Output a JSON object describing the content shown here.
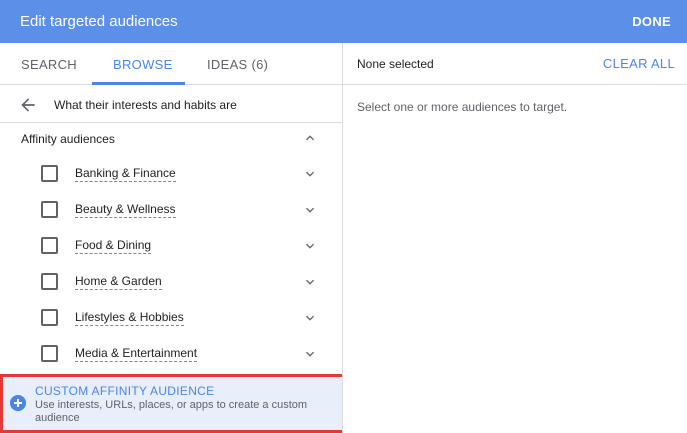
{
  "header": {
    "title": "Edit targeted audiences",
    "done_label": "DONE"
  },
  "tabs": [
    {
      "label": "SEARCH",
      "active": false
    },
    {
      "label": "BROWSE",
      "active": true
    },
    {
      "label": "IDEAS",
      "count": "(6)",
      "active": false
    }
  ],
  "breadcrumb": {
    "text": "What their interests and habits are",
    "back_icon": "arrow-back-icon"
  },
  "section": {
    "title": "Affinity audiences",
    "expanded": true
  },
  "items": [
    {
      "label": "Banking & Finance",
      "checked": false
    },
    {
      "label": "Beauty & Wellness",
      "checked": false
    },
    {
      "label": "Food & Dining",
      "checked": false
    },
    {
      "label": "Home & Garden",
      "checked": false
    },
    {
      "label": "Lifestyles & Hobbies",
      "checked": false
    },
    {
      "label": "Media & Entertainment",
      "checked": false
    }
  ],
  "custom": {
    "title": "CUSTOM AFFINITY AUDIENCE",
    "description": "Use interests, URLs, places, or apps to create a custom audience",
    "icon": "plus-circle-icon"
  },
  "right": {
    "status": "None selected",
    "clear_label": "CLEAR ALL",
    "hint": "Select one or more audiences to target."
  },
  "colors": {
    "header_bg": "#5c8fe8",
    "accent": "#4a86e8",
    "highlight_border": "#e53935"
  }
}
